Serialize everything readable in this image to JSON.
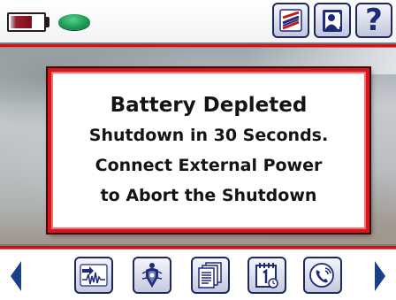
{
  "status_bar": {
    "battery_icon": "battery-low-icon",
    "status_indicator_icon": "status-led-icon",
    "status_indicator_color": "#1e9a56",
    "buttons": [
      {
        "icon": "chart-icon"
      },
      {
        "icon": "contact-card-icon"
      },
      {
        "icon": "help-icon",
        "glyph": "?"
      }
    ]
  },
  "alert": {
    "title": "Battery Depleted",
    "lines": [
      "Shutdown in 30 Seconds.",
      "Connect External Power",
      "to Abort the Shutdown"
    ],
    "border_color": "#d3171f"
  },
  "toolbar": {
    "prev_icon": "arrow-left-icon",
    "next_icon": "arrow-right-icon",
    "buttons": [
      {
        "icon": "waveform-import-icon"
      },
      {
        "icon": "emblem-icon"
      },
      {
        "icon": "documents-icon"
      },
      {
        "icon": "calendar-icon"
      },
      {
        "icon": "phone-icon"
      }
    ]
  },
  "colors": {
    "accent_red": "#c8161e",
    "icon_blue": "#1e2a7a",
    "arrow_blue": "#1a3f8a"
  }
}
